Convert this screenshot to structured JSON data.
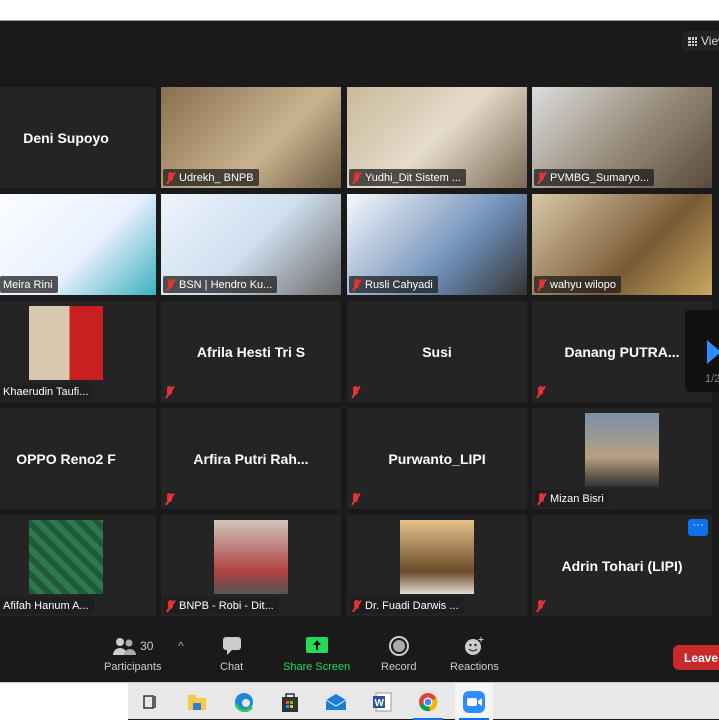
{
  "toolbar_top": {
    "view_label": "View"
  },
  "tiles": [
    {
      "name": "Deni Supoyo",
      "kind": "name",
      "muted": false
    },
    {
      "name": "Udrekh_ BNPB",
      "kind": "video",
      "muted": true
    },
    {
      "name": "Yudhi_Dit Sistem ...",
      "kind": "video",
      "muted": true
    },
    {
      "name": "PVMBG_Sumaryo...",
      "kind": "video",
      "muted": true
    },
    {
      "name": "Meira Rini",
      "kind": "video",
      "muted": false
    },
    {
      "name": "BSN | Hendro Ku...",
      "kind": "video",
      "muted": true
    },
    {
      "name": "Rusli Cahyadi",
      "kind": "video",
      "muted": true
    },
    {
      "name": "wahyu wilopo",
      "kind": "video",
      "muted": true
    },
    {
      "name": "Khaerudin Taufi...",
      "kind": "avatar",
      "muted": false
    },
    {
      "name": "Afrila Hesti Tri S",
      "kind": "name",
      "muted": true
    },
    {
      "name": "Susi",
      "kind": "name",
      "muted": true
    },
    {
      "name": "Danang  PUTRA...",
      "kind": "name",
      "muted": true
    },
    {
      "name": "OPPO Reno2 F",
      "kind": "name",
      "muted": false
    },
    {
      "name": "Arfira  Putri Rah...",
      "kind": "name",
      "muted": true
    },
    {
      "name": "Purwanto_LIPI",
      "kind": "name",
      "muted": true
    },
    {
      "name": "Mizan Bisri",
      "kind": "avatar",
      "muted": true
    },
    {
      "name": "Afifah Hanum A...",
      "kind": "avatar",
      "muted": false
    },
    {
      "name": "BNPB - Robi - Dit...",
      "kind": "avatar",
      "muted": true
    },
    {
      "name": "Dr. Fuadi Darwis ...",
      "kind": "avatar",
      "muted": true
    },
    {
      "name": "Adrin Tohari (LIPI)",
      "kind": "name",
      "muted": true,
      "more": "···"
    }
  ],
  "pagination": {
    "page": "1/2"
  },
  "controls": {
    "participants_label": "Participants",
    "participants_count": "30",
    "chat_label": "Chat",
    "share_label": "Share Screen",
    "record_label": "Record",
    "reactions_label": "Reactions",
    "leave_label": "Leave"
  },
  "colors": {
    "accent": "#0e72ed",
    "share": "#23d959",
    "leave": "#c62a2a"
  },
  "taskbar": [
    "task-view-icon",
    "file-explorer-icon",
    "edge-icon",
    "store-icon",
    "mail-icon",
    "word-icon",
    "chrome-icon",
    "zoom-icon"
  ]
}
